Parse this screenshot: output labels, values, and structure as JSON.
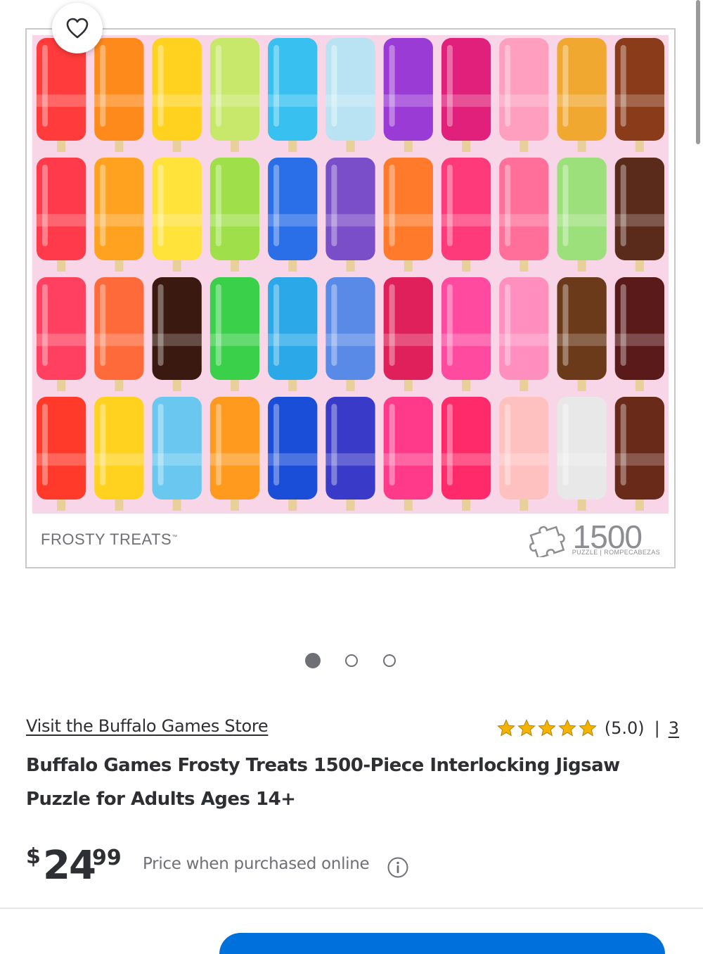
{
  "product_image": {
    "brand_line": "FROSTY TREATS",
    "trademark": "™",
    "piece_count": "1500",
    "piece_subtitle": "PUZZLE | ROMPECABEZAS"
  },
  "carousel": {
    "total": 3,
    "active_index": 0
  },
  "store": {
    "link_text": "Visit the Buffalo Games Store"
  },
  "rating": {
    "stars": 5,
    "score_text": "(5.0)",
    "separator": "|",
    "review_count": "3",
    "star_color": "#f5b301"
  },
  "title": "Buffalo Games Frosty Treats 1500-Piece Interlocking Jigsaw Puzzle for Adults Ages 14+",
  "price": {
    "currency": "$",
    "dollars": "24",
    "cents": "99",
    "note": "Price when purchased online"
  },
  "colors": {
    "accent": "#0071dc",
    "text": "#2e2f32",
    "muted": "#6f7075"
  },
  "icons": [
    "heart-icon",
    "info-icon",
    "puzzle-piece-icon",
    "star-icon"
  ]
}
